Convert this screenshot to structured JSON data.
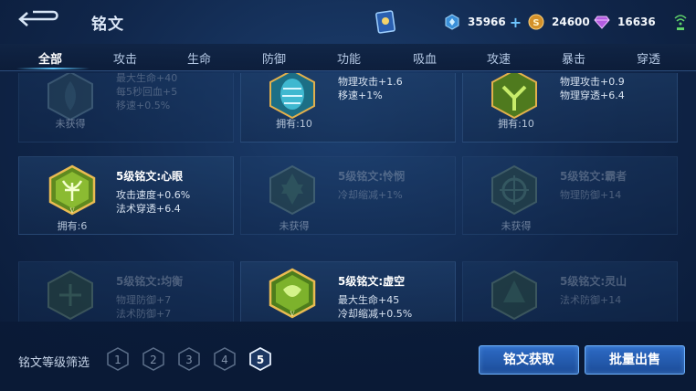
{
  "header": {
    "title": "铭文",
    "currencies": [
      {
        "value": "35966",
        "icon": "diamond-coin-icon"
      },
      {
        "value": "24600",
        "icon": "gold-coin-icon"
      },
      {
        "value": "16636",
        "icon": "purple-gem-icon"
      }
    ],
    "plus": "+"
  },
  "tabs": [
    "全部",
    "攻击",
    "生命",
    "防御",
    "功能",
    "吸血",
    "攻速",
    "暴击",
    "穿透"
  ],
  "grid": {
    "rows": [
      [
        {
          "name": "",
          "stats": [
            "最大生命+40",
            "每5秒回血+5",
            "移速+0.5%"
          ],
          "owned": "未获得",
          "dim": true
        },
        {
          "name": "",
          "stats": [
            "物理攻击+1.6",
            "移速+1%"
          ],
          "owned": "拥有:10",
          "dim": false
        },
        {
          "name": "",
          "stats": [
            "物理攻击+0.9",
            "物理穿透+6.4"
          ],
          "owned": "拥有:10",
          "dim": false
        }
      ],
      [
        {
          "name": "5级铭文:心眼",
          "stats": [
            "攻击速度+0.6%",
            "法术穿透+6.4"
          ],
          "owned": "拥有:6",
          "dim": false
        },
        {
          "name": "5级铭文:怜悯",
          "stats": [
            "冷却缩减+1%"
          ],
          "owned": "未获得",
          "dim": true
        },
        {
          "name": "5级铭文:霸者",
          "stats": [
            "物理防御+14"
          ],
          "owned": "未获得",
          "dim": true
        }
      ],
      [
        {
          "name": "5级铭文:均衡",
          "stats": [
            "物理防御+7",
            "法术防御+7"
          ],
          "owned": "",
          "dim": true
        },
        {
          "name": "5级铭文:虚空",
          "stats": [
            "最大生命+45",
            "冷却缩减+0.5%"
          ],
          "owned": "",
          "dim": false
        },
        {
          "name": "5级铭文:灵山",
          "stats": [
            "法术防御+14"
          ],
          "owned": "",
          "dim": true
        }
      ]
    ]
  },
  "footer": {
    "filter_label": "铭文等级筛选",
    "levels": [
      "1",
      "2",
      "3",
      "4",
      "5"
    ],
    "active_level": "5",
    "get_button": "铭文获取",
    "sell_button": "批量出售"
  },
  "colors": {
    "accent": "#5ec8ff",
    "button": "#2d6bc6",
    "gem_green": "#6f9a2a",
    "gem_teal": "#2f8f9a"
  }
}
